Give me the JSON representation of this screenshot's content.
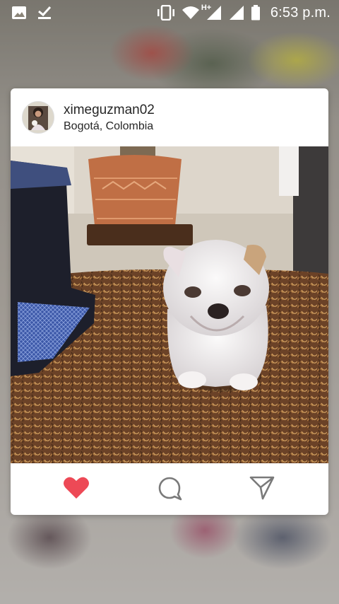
{
  "status_bar": {
    "time": "6:53 p.m.",
    "network_label": "H+",
    "icons": [
      "gallery-icon",
      "download-done-icon",
      "vibrate-icon",
      "wifi-icon",
      "signal-icon",
      "signal-icon",
      "battery-icon"
    ]
  },
  "post": {
    "username": "ximeguzman02",
    "location": "Bogotá, Colombia",
    "image_description": "white bulldog puppy on brown shag rug",
    "liked": true
  },
  "actions": [
    "heart-icon",
    "comment-icon",
    "share-icon"
  ],
  "colors": {
    "like_red": "#ed4956",
    "icon_gray": "#7a7a7a",
    "text": "#262626"
  }
}
